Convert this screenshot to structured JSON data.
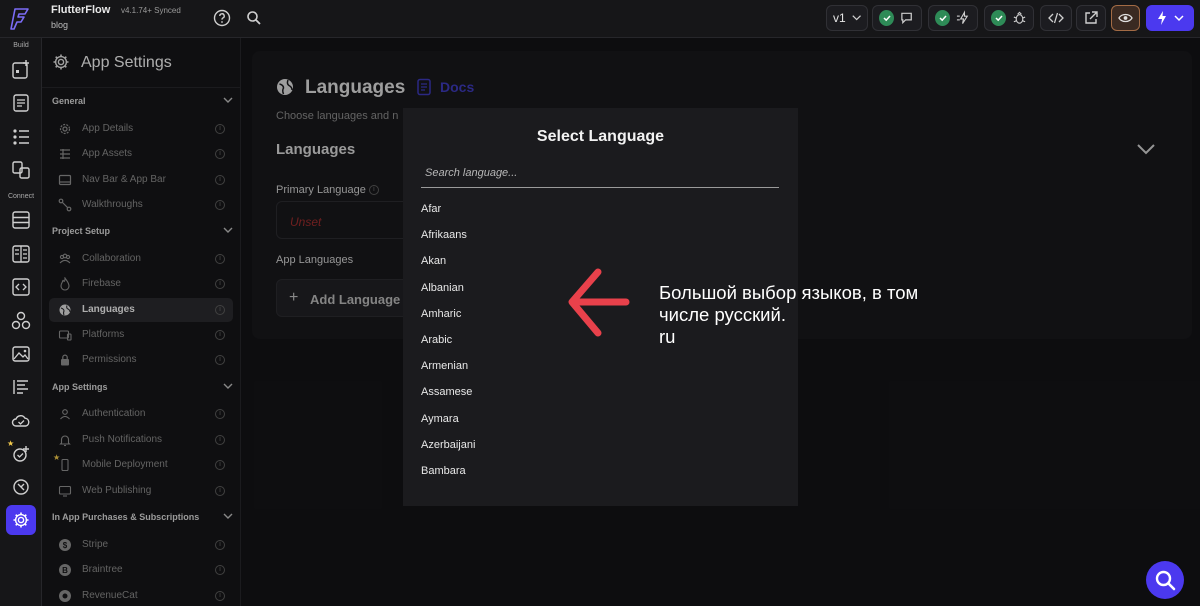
{
  "app": {
    "name": "FlutterFlow",
    "version": "v4.1.74+ Synced",
    "project": "blog"
  },
  "topbar": {
    "version_select": "v1"
  },
  "rail": {
    "build_label": "Build",
    "connect_label": "Connect"
  },
  "sidebar": {
    "title": "App Settings",
    "sections": [
      {
        "label": "General",
        "items": [
          "App Details",
          "App Assets",
          "Nav Bar & App Bar",
          "Walkthroughs"
        ]
      },
      {
        "label": "Project Setup",
        "items": [
          "Collaboration",
          "Firebase",
          "Languages",
          "Platforms",
          "Permissions"
        ]
      },
      {
        "label": "App Settings",
        "items": [
          "Authentication",
          "Push Notifications",
          "Mobile Deployment",
          "Web Publishing"
        ]
      },
      {
        "label": "In App Purchases & Subscriptions",
        "items": [
          "Stripe",
          "Braintree",
          "RevenueCat"
        ]
      }
    ],
    "active_item": "Languages"
  },
  "main": {
    "title": "Languages",
    "docs_label": "Docs",
    "subtitle": "Choose languages and n",
    "section_title": "Languages",
    "primary_language_label": "Primary Language",
    "primary_language_value": "Unset",
    "app_languages_label": "App Languages",
    "add_language_label": "Add Language"
  },
  "modal": {
    "title": "Select Language",
    "search_placeholder": "Search language...",
    "languages": [
      "Afar",
      "Afrikaans",
      "Akan",
      "Albanian",
      "Amharic",
      "Arabic",
      "Armenian",
      "Assamese",
      "Aymara",
      "Azerbaijani",
      "Bambara"
    ]
  },
  "annotation": {
    "line1": "Большой выбор языков, в том",
    "line2": "числе русский.",
    "line3": "ru",
    "arrow_color": "#e8414b"
  },
  "colors": {
    "accent": "#4b39ef",
    "status_green": "#2e8b57",
    "unset_red": "#9b2c2c",
    "docs_link": "#3c39b8"
  }
}
